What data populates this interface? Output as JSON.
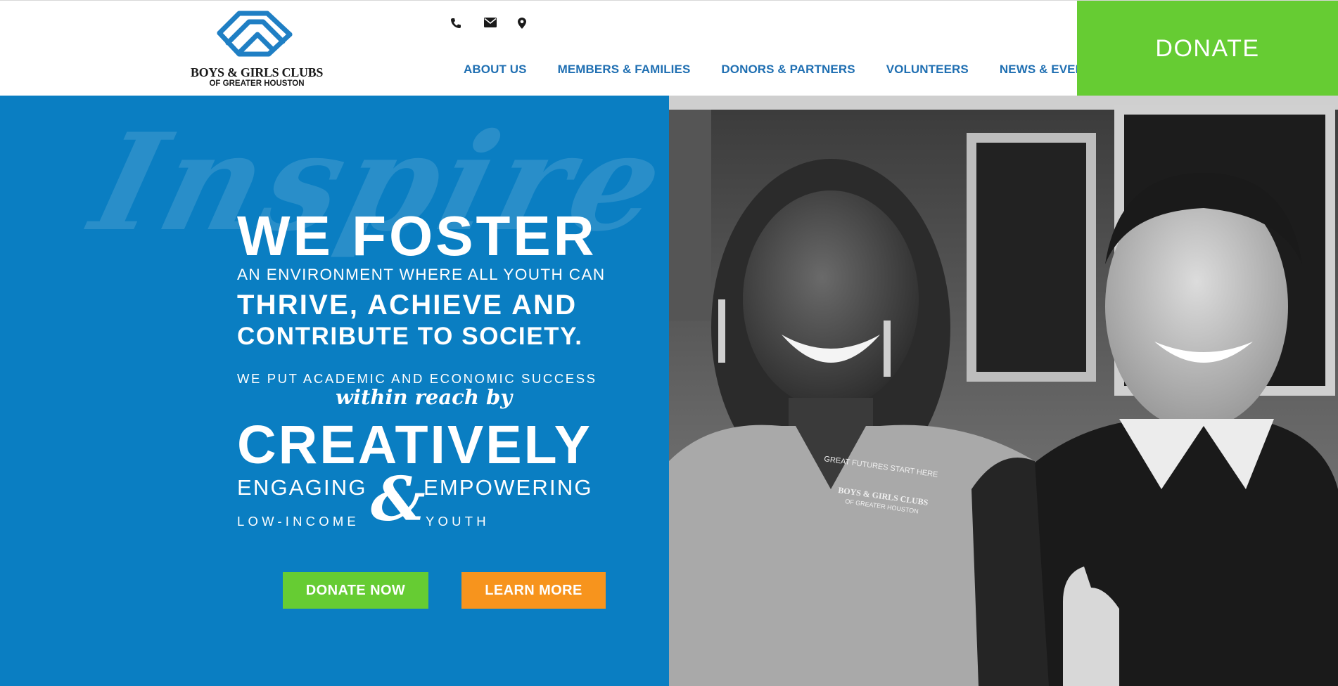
{
  "header": {
    "logo": {
      "line1": "BOYS & GIRLS CLUBS",
      "line2": "OF GREATER HOUSTON",
      "brand_color": "#1f7fc4"
    },
    "contact_icons": [
      "phone-icon",
      "envelope-icon",
      "map-pin-icon"
    ],
    "nav": [
      "ABOUT US",
      "MEMBERS & FAMILIES",
      "DONORS & PARTNERS",
      "VOLUNTEERS",
      "NEWS & EVENTS"
    ],
    "donate_label": "DONATE"
  },
  "hero": {
    "watermark": "Inspire",
    "headline": "WE FOSTER",
    "line_environment": "AN ENVIRONMENT WHERE ALL YOUTH CAN",
    "line_thrive": "THRIVE, ACHIEVE AND",
    "line_contribute": "CONTRIBUTE TO SOCIETY.",
    "line_academic": "WE PUT ACADEMIC AND ECONOMIC SUCCESS",
    "line_within": "within reach by",
    "line_creatively": "CREATIVELY",
    "line_engaging": "ENGAGING",
    "ampersand": "&",
    "line_empowering": "EMPOWERING",
    "line_lowincome": "LOW-INCOME",
    "line_youth": "YOUTH",
    "donate_now_label": "DONATE NOW",
    "learn_more_label": "LEARN MORE",
    "photo_shirt_text": "GREAT FUTURES START HERE",
    "photo_logo_line1": "BOYS & GIRLS CLUBS",
    "photo_logo_line2": "OF GREATER HOUSTON"
  },
  "colors": {
    "hero_blue": "#0a7ec2",
    "nav_blue": "#1f6fb2",
    "donate_green": "#66cc33",
    "learn_orange": "#f7941d"
  }
}
